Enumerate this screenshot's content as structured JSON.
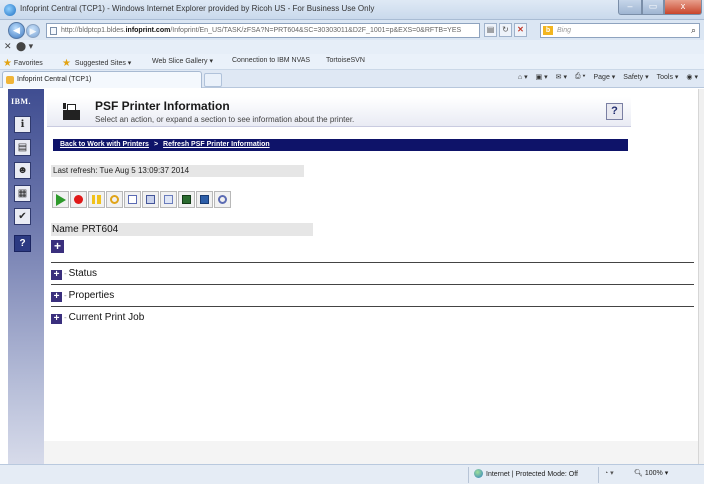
{
  "window": {
    "title": "Infoprint Central (TCP1) - Windows Internet Explorer provided by Ricoh US - For Business Use Only",
    "min": "–",
    "max": "▭",
    "close": "x"
  },
  "address": {
    "url_prefix": "http://bldptcp1.bldes.",
    "url_bold": "infoprint.com",
    "url_suffix": "/Infoprint/En_US/TASK/zFSA?N=PRT604&SC=30303011&D2F_1001=p&EXS=0&RFTB=YES",
    "search_placeholder": "Bing",
    "search_brand": "b"
  },
  "favorites": {
    "label": "Favorites",
    "items": [
      "Suggested Sites ▾",
      "Web Slice Gallery ▾",
      "Connection to IBM NVAS",
      "TortoiseSVN"
    ]
  },
  "tab": {
    "label": "Infoprint Central (TCP1)"
  },
  "commands": [
    "Page ▾",
    "Safety ▾",
    "Tools ▾"
  ],
  "nav": {
    "brand": "IBM."
  },
  "header": {
    "title": "PSF Printer Information",
    "subtitle": "Select an action, or expand a section to see information about the printer.",
    "help": "?"
  },
  "breadcrumb": {
    "back": "Back to Work with Printers",
    "sep": ">",
    "refresh": "Refresh PSF Printer Information"
  },
  "refresh": {
    "text": "Last refresh: Tue Aug 5 13:09:37 2014"
  },
  "printer": {
    "label": "Name",
    "name": "PRT604"
  },
  "sections": [
    "Status",
    "Properties",
    "Current Print Job"
  ],
  "status_bar": {
    "zone": "Internet | Protected Mode: Off",
    "zoom": "100%"
  },
  "colors": {
    "nav_dark": "#3f4d91",
    "breadcrumb_bg": "#0e1369",
    "expand_button": "#3a2f7d"
  }
}
